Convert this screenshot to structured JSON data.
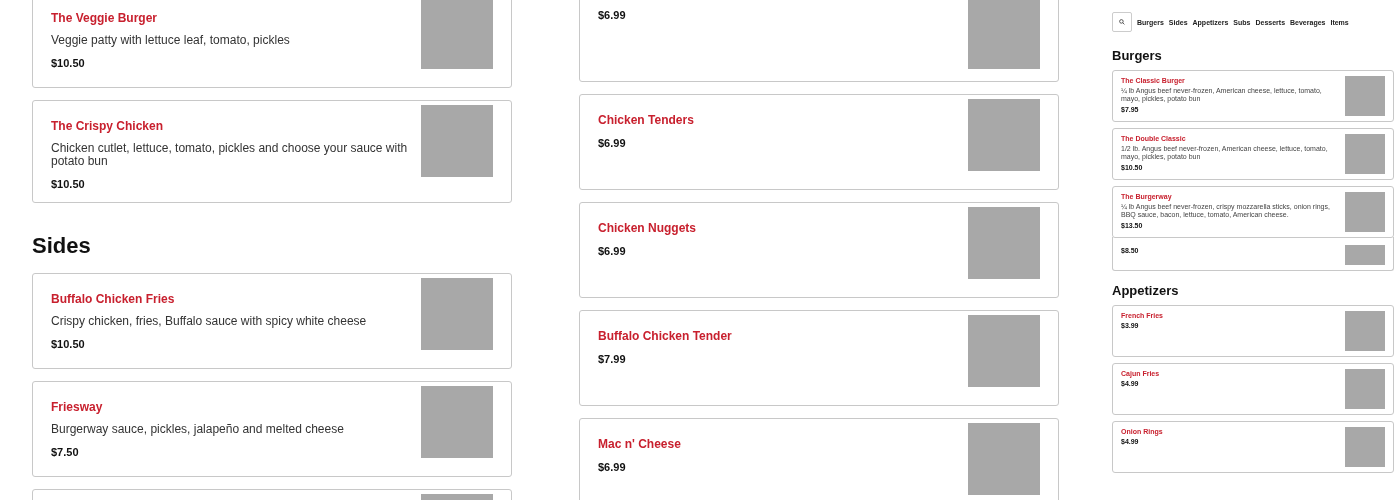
{
  "left_column": {
    "sections": [
      {
        "items": [
          {
            "name": "The Veggie Burger",
            "description": "Veggie patty with lettuce leaf, tomato, pickles",
            "price": "$10.50"
          },
          {
            "name": "The Crispy Chicken",
            "description": "Chicken cutlet, lettuce, tomato, pickles and choose your sauce with potato bun",
            "price": "$10.50"
          }
        ]
      },
      {
        "heading": "Sides",
        "items": [
          {
            "kind": "full",
            "name": "Buffalo Chicken Fries",
            "description": "Crispy chicken, fries, Buffalo sauce with spicy white cheese",
            "price": "$10.50"
          },
          {
            "kind": "full",
            "name": "Friesway",
            "description": "Burgerway sauce, pickles, jalapeño and melted cheese",
            "price": "$7.50"
          },
          {
            "kind": "cut_off"
          }
        ]
      }
    ]
  },
  "middle_column": {
    "items": [
      {
        "price": "$6.99"
      },
      {
        "name": "Chicken Tenders",
        "price": "$6.99"
      },
      {
        "name": "Chicken Nuggets",
        "price": "$6.99"
      },
      {
        "name": "Buffalo Chicken Tender",
        "price": "$7.99"
      },
      {
        "name": "Mac n' Cheese",
        "price": "$6.99"
      }
    ]
  },
  "preview": {
    "nav": [
      "Burgers",
      "Sides",
      "Appetizers",
      "Subs",
      "Desserts",
      "Beverages",
      "Items"
    ],
    "sections": [
      {
        "heading": "Burgers",
        "items": [
          {
            "name": "The Classic Burger",
            "description": "¼ lb Angus beef never-frozen, American cheese, lettuce, tomato, mayo, pickles, potato bun",
            "price": "$7.95"
          },
          {
            "name": "The Double Classic",
            "description": "1/2 lb. Angus beef never-frozen, American cheese, lettuce, tomato, mayo, pickles, potato bun",
            "price": "$10.50"
          },
          {
            "name": "The Burgerway",
            "description": "¼ lb Angus beef never-frozen, crispy mozzarella sticks, onion rings, BBQ sauce, bacon, lettuce, tomato, American cheese.",
            "price": "$13.50"
          },
          {
            "price": "$8.50"
          }
        ]
      },
      {
        "heading": "Appetizers",
        "items": [
          {
            "name": "French Fries",
            "price": "$3.99"
          },
          {
            "name": "Cajun Fries",
            "price": "$4.99"
          },
          {
            "name": "Onion Rings",
            "price": "$4.99"
          }
        ]
      }
    ]
  }
}
